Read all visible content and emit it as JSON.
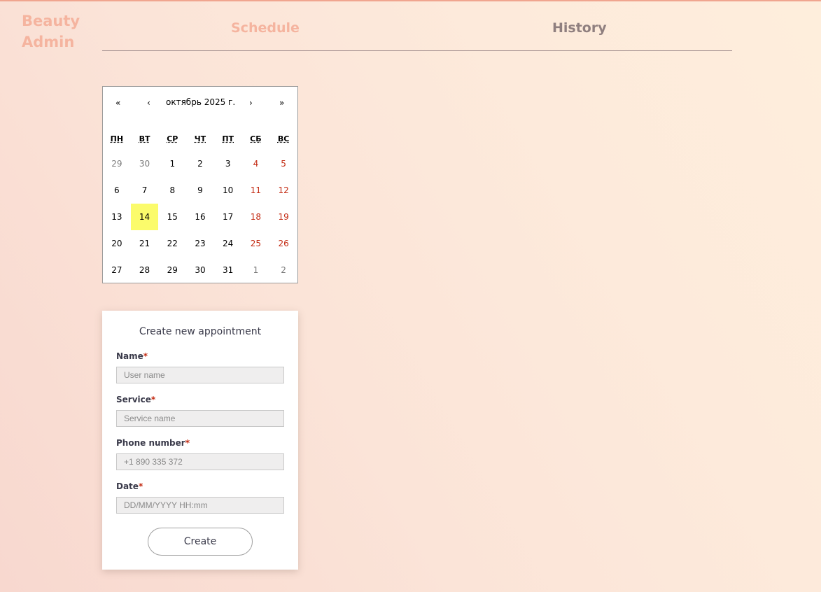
{
  "app": {
    "logo_line1": "Beauty",
    "logo_line2": "Admin"
  },
  "nav": {
    "tabs": [
      {
        "label": "Schedule",
        "active": true
      },
      {
        "label": "History",
        "active": false
      }
    ]
  },
  "calendar": {
    "prev_year": "«",
    "prev_month": "‹",
    "title": "октябрь 2025 г.",
    "next_month": "›",
    "next_year": "»",
    "weekdays": [
      "ПН",
      "ВТ",
      "СР",
      "ЧТ",
      "ПТ",
      "СБ",
      "ВС"
    ],
    "today": "14",
    "weeks": [
      [
        {
          "d": "29",
          "t": "other"
        },
        {
          "d": "30",
          "t": "other"
        },
        {
          "d": "1",
          "t": ""
        },
        {
          "d": "2",
          "t": ""
        },
        {
          "d": "3",
          "t": ""
        },
        {
          "d": "4",
          "t": "weekend"
        },
        {
          "d": "5",
          "t": "weekend"
        }
      ],
      [
        {
          "d": "6",
          "t": ""
        },
        {
          "d": "7",
          "t": ""
        },
        {
          "d": "8",
          "t": ""
        },
        {
          "d": "9",
          "t": ""
        },
        {
          "d": "10",
          "t": ""
        },
        {
          "d": "11",
          "t": "weekend"
        },
        {
          "d": "12",
          "t": "weekend"
        }
      ],
      [
        {
          "d": "13",
          "t": ""
        },
        {
          "d": "14",
          "t": "today"
        },
        {
          "d": "15",
          "t": ""
        },
        {
          "d": "16",
          "t": ""
        },
        {
          "d": "17",
          "t": ""
        },
        {
          "d": "18",
          "t": "weekend"
        },
        {
          "d": "19",
          "t": "weekend"
        }
      ],
      [
        {
          "d": "20",
          "t": ""
        },
        {
          "d": "21",
          "t": ""
        },
        {
          "d": "22",
          "t": ""
        },
        {
          "d": "23",
          "t": ""
        },
        {
          "d": "24",
          "t": ""
        },
        {
          "d": "25",
          "t": "weekend"
        },
        {
          "d": "26",
          "t": "weekend"
        }
      ],
      [
        {
          "d": "27",
          "t": ""
        },
        {
          "d": "28",
          "t": ""
        },
        {
          "d": "29",
          "t": ""
        },
        {
          "d": "30",
          "t": ""
        },
        {
          "d": "31",
          "t": ""
        },
        {
          "d": "1",
          "t": "other"
        },
        {
          "d": "2",
          "t": "other"
        }
      ]
    ]
  },
  "form": {
    "title": "Create new appointment",
    "required_mark": "*",
    "fields": {
      "name": {
        "label": "Name",
        "placeholder": "User name",
        "value": ""
      },
      "service": {
        "label": "Service",
        "placeholder": "Service name",
        "value": ""
      },
      "phone": {
        "label": "Phone number",
        "placeholder": "+1 890 335 372",
        "value": ""
      },
      "date": {
        "label": "Date",
        "placeholder": "DD/MM/YYYY HH:mm",
        "value": ""
      }
    },
    "submit_label": "Create"
  },
  "colors": {
    "accent": "#f5b49f",
    "required": "#c32a12",
    "today_highlight": "#fbfb6b",
    "weekend": "#c32a12"
  }
}
